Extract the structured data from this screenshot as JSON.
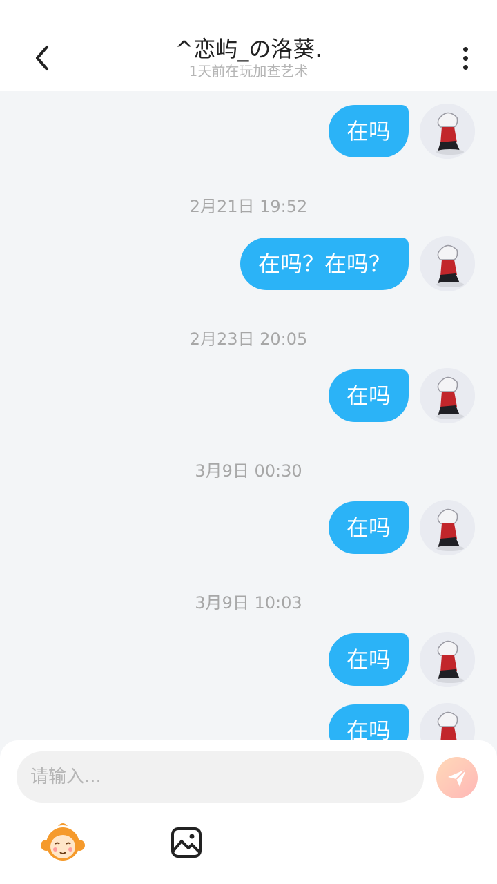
{
  "header": {
    "title": "^恋屿_の洛葵.",
    "subtitle": "1天前在玩加查艺术",
    "back_icon": "chevron-left-icon",
    "more_icon": "more-vertical-icon"
  },
  "messages": [
    {
      "text": "在吗"
    },
    {
      "timestamp": "2月21日 19:52",
      "text": "在吗？在吗？"
    },
    {
      "timestamp": "2月23日 20:05",
      "text": "在吗"
    },
    {
      "timestamp": "3月9日 00:30",
      "text": "在吗"
    },
    {
      "timestamp": "3月9日 10:03",
      "text": "在吗"
    },
    {
      "text": "在吗"
    }
  ],
  "input": {
    "placeholder": "请输入...",
    "value": ""
  },
  "toolbar": {
    "send_icon": "send-icon",
    "emoji_icon": "monkey-emoji-icon",
    "image_icon": "image-icon"
  },
  "colors": {
    "bubble": "#2bb3f7",
    "background": "#f3f5f7",
    "send_button": "#ffc4b8"
  }
}
